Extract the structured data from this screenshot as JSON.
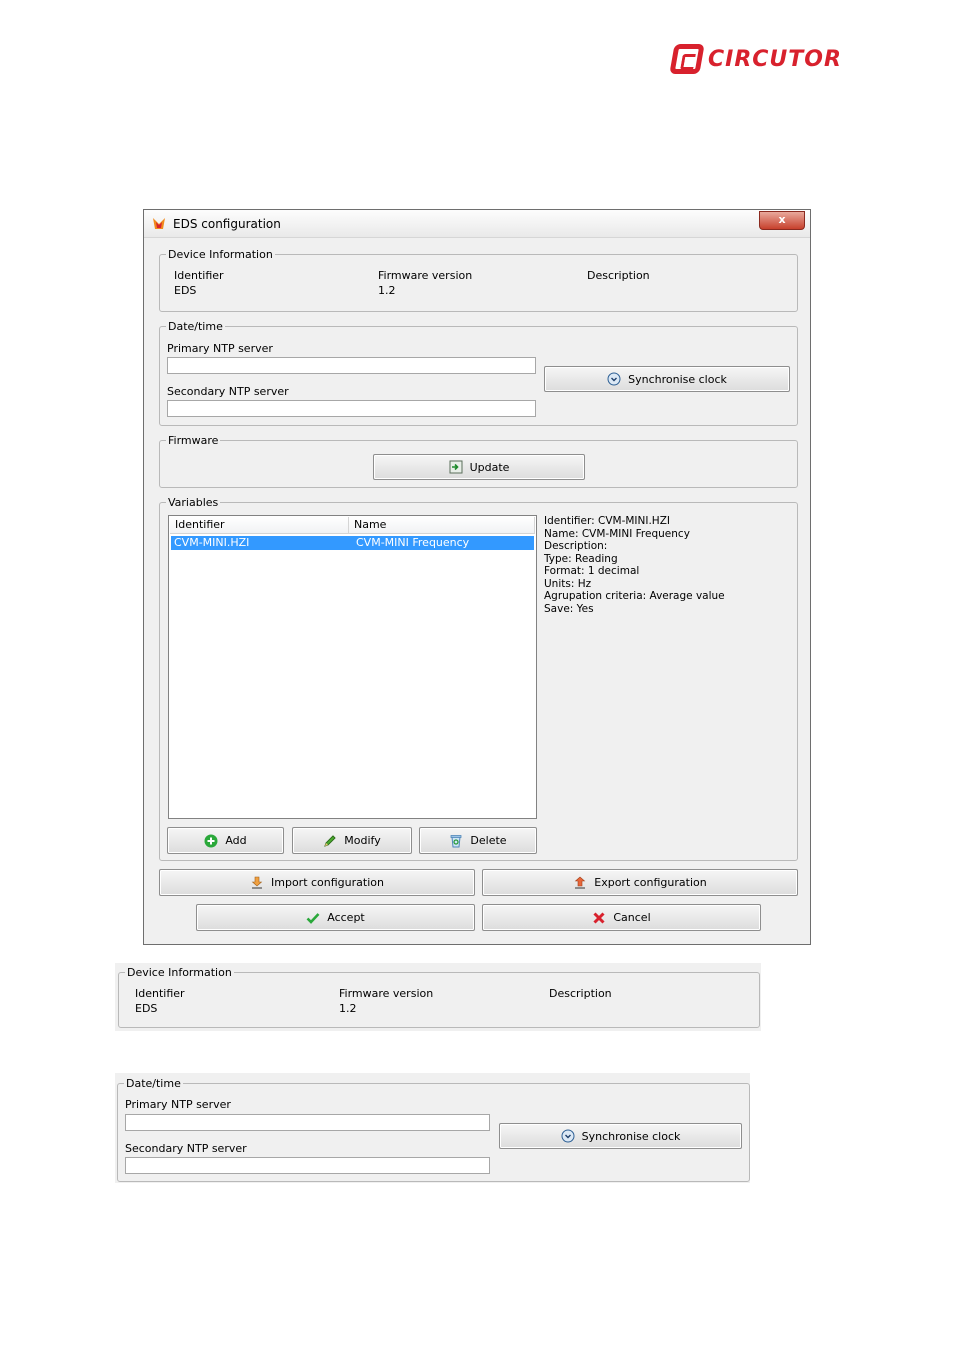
{
  "brand": {
    "logo_text": "CIRCUTOR",
    "color": "#d8212d"
  },
  "window": {
    "title": "EDS configuration",
    "close_glyph": "x",
    "device_info": {
      "legend": "Device Information",
      "col_identifier": "Identifier",
      "col_firmware": "Firmware version",
      "col_description": "Description",
      "identifier": "EDS",
      "firmware": "1.2",
      "description": ""
    },
    "datetime": {
      "legend": "Date/time",
      "primary_label": "Primary NTP server",
      "primary_value": "",
      "secondary_label": "Secondary NTP server",
      "secondary_value": "",
      "sync_button": "Synchronise clock"
    },
    "firmware": {
      "legend": "Firmware",
      "update_button": "Update"
    },
    "variables": {
      "legend": "Variables",
      "columns": [
        "Identifier",
        "Name"
      ],
      "rows": [
        {
          "identifier": "CVM-MINI.HZI",
          "name": "CVM-MINI Frequency",
          "selected": true
        }
      ],
      "details": [
        "Identifier: CVM-MINI.HZI",
        "Name: CVM-MINI Frequency",
        "Description:",
        "Type: Reading",
        "Format: 1 decimal",
        "Units: Hz",
        "Agrupation criteria:  Average value",
        "Save: Yes"
      ],
      "add_button": "Add",
      "modify_button": "Modify",
      "delete_button": "Delete"
    },
    "import_button": "Import configuration",
    "export_button": "Export configuration",
    "accept_button": "Accept",
    "cancel_button": "Cancel"
  },
  "zoom_device_info": {
    "legend": "Device Information",
    "col_identifier": "Identifier",
    "col_firmware": "Firmware version",
    "col_description": "Description",
    "identifier": "EDS",
    "firmware": "1.2"
  },
  "zoom_datetime": {
    "legend": "Date/time",
    "primary_label": "Primary NTP server",
    "secondary_label": "Secondary NTP server",
    "sync_button": "Synchronise clock"
  },
  "icons": {
    "app": "flame-icon",
    "sync": "clock-icon",
    "update": "update-icon",
    "add": "plus-icon",
    "modify": "pencil-icon",
    "delete": "recycle-bin-icon",
    "import": "import-icon",
    "export": "export-icon",
    "accept": "checkmark-icon",
    "cancel": "red-x-icon"
  }
}
